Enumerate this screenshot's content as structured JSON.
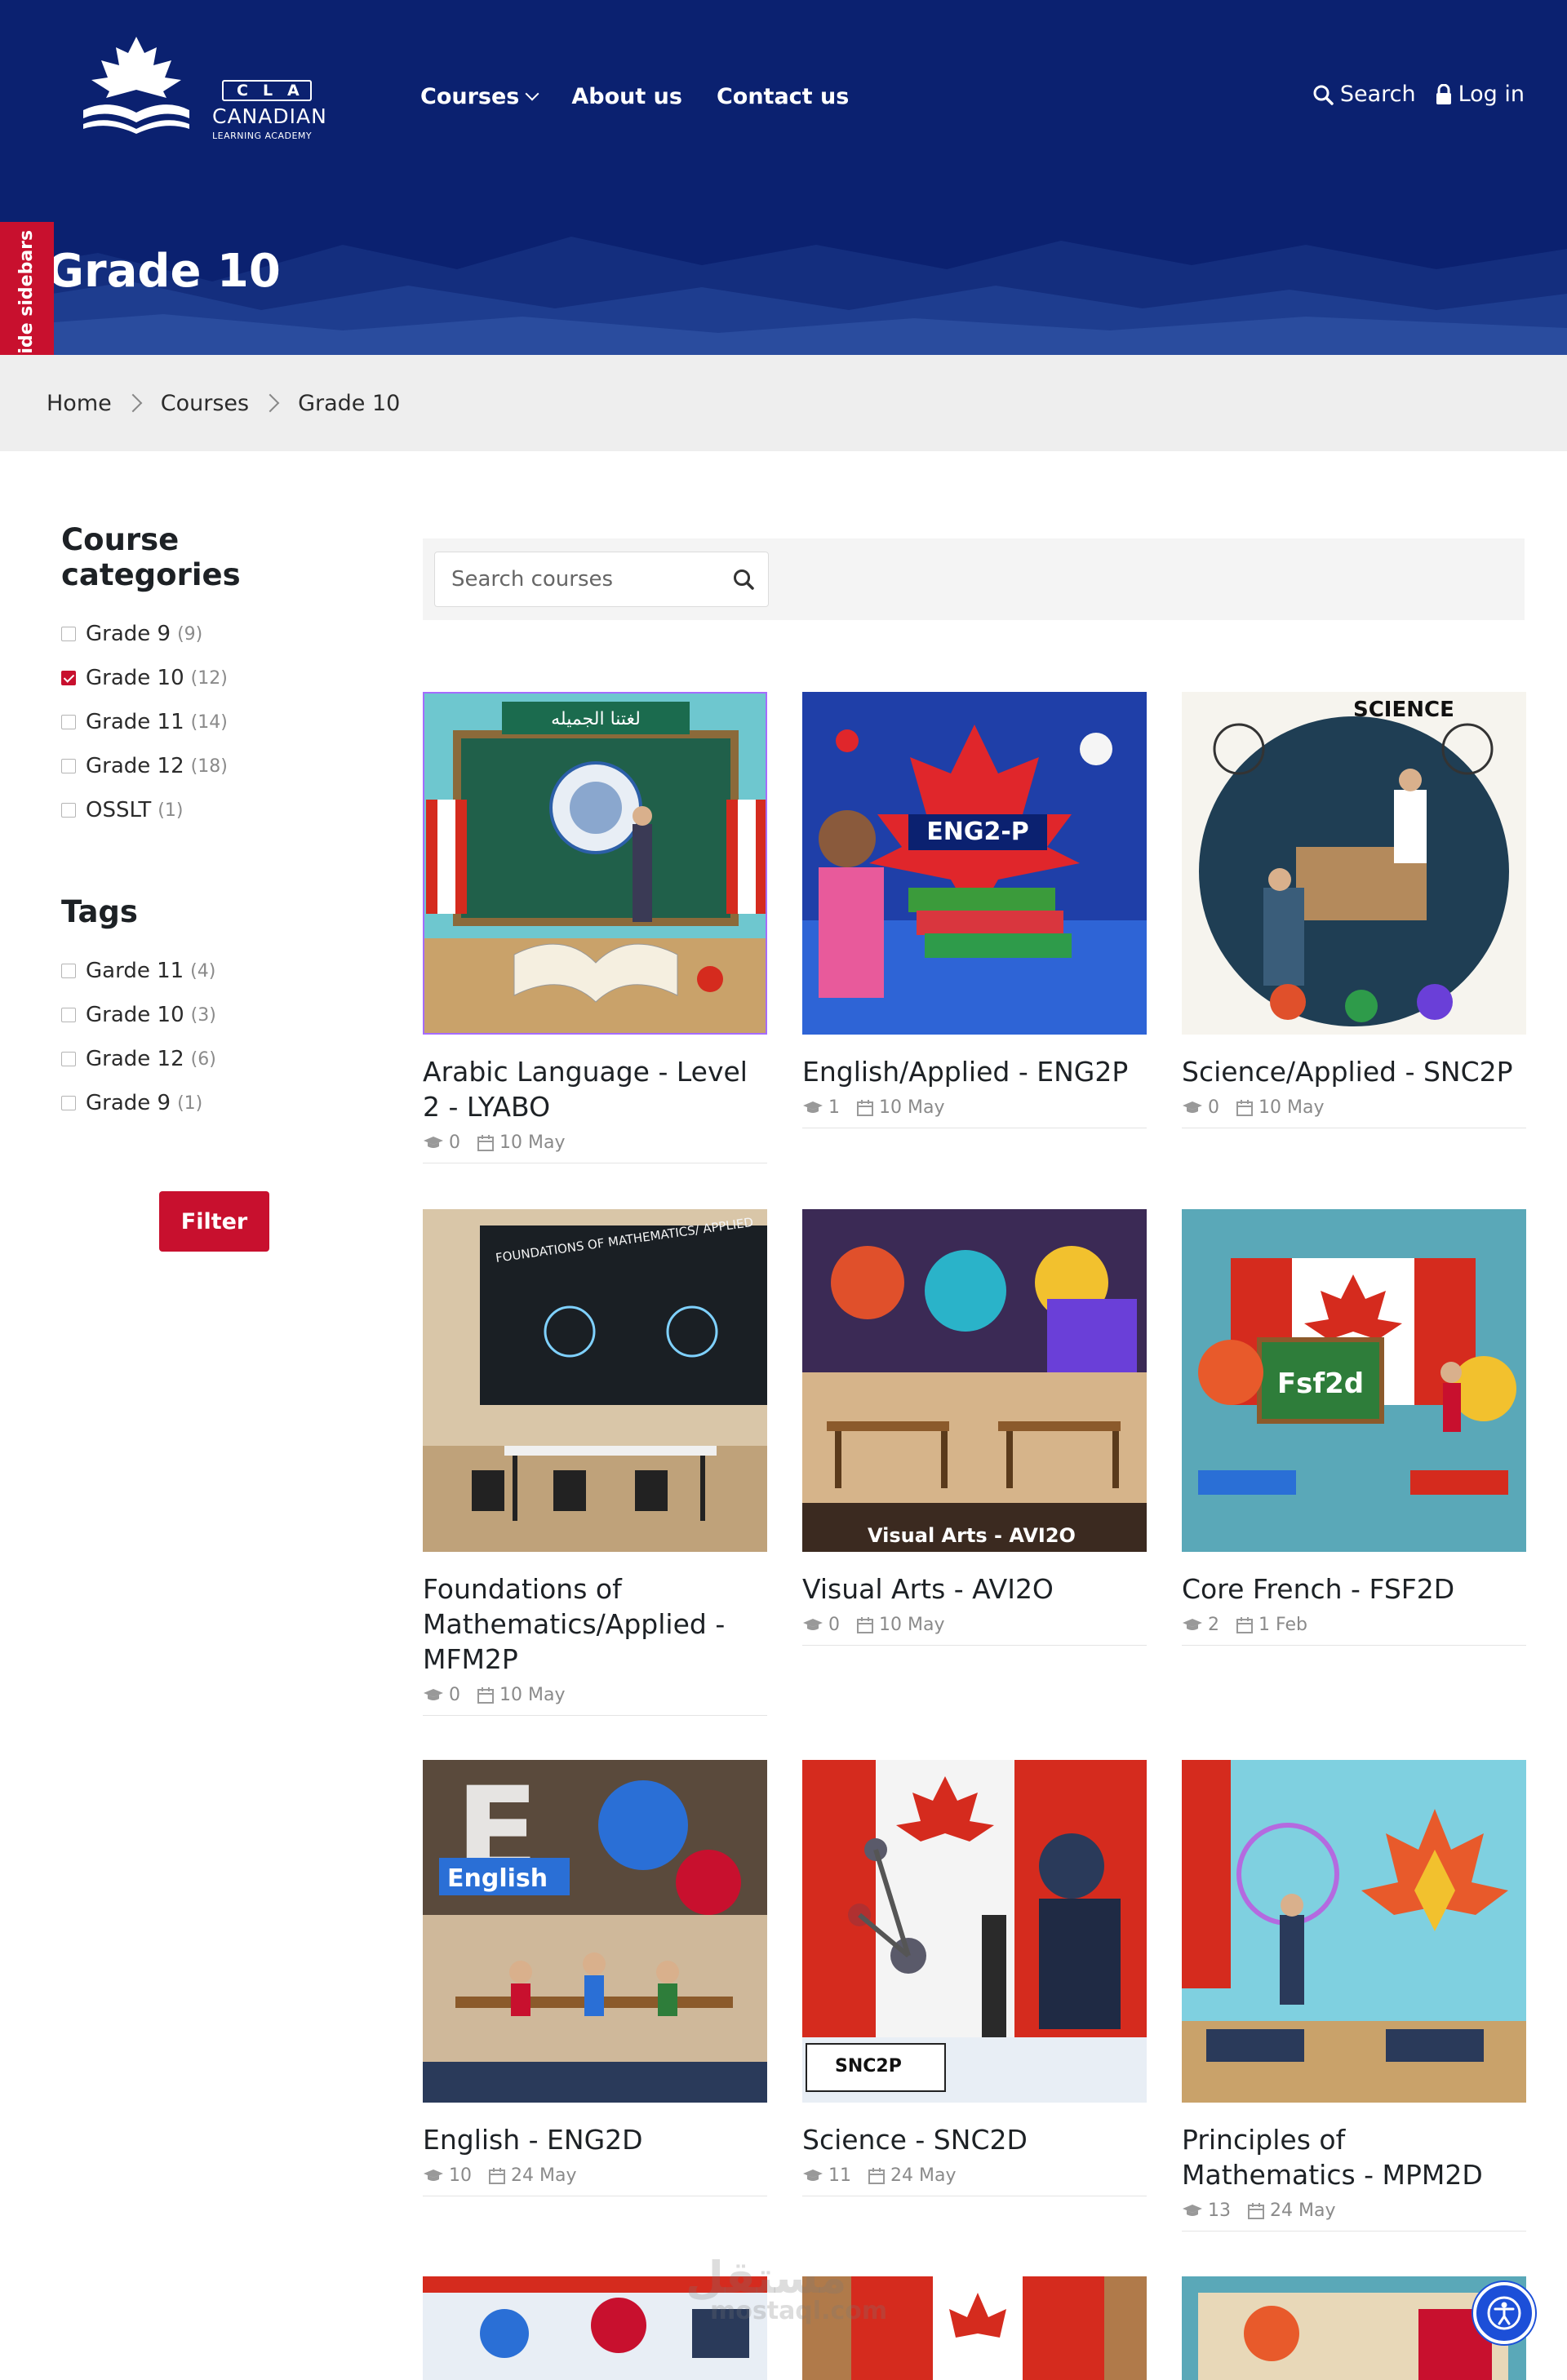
{
  "header": {
    "logo": {
      "badge": "CLA",
      "name": "CANADIAN",
      "sub": "LEARNING ACADEMY"
    },
    "nav": [
      {
        "label": "Courses",
        "icon": "chevron-down-icon"
      },
      {
        "label": "About us"
      },
      {
        "label": "Contact us"
      }
    ],
    "search_label": "Search",
    "login_label": "Log in",
    "page_title": "Grade 10",
    "colors": {
      "header_bg": "#0b2170",
      "accent": "#c8102e"
    }
  },
  "sidebar_toggle": {
    "label": "Hide sidebars",
    "icon": "bar-chart-icon"
  },
  "breadcrumb": [
    "Home",
    "Courses",
    "Grade 10"
  ],
  "filters": {
    "categories_heading": "Course categories",
    "categories": [
      {
        "label": "Grade 9",
        "count": "(9)",
        "checked": false
      },
      {
        "label": "Grade 10",
        "count": "(12)",
        "checked": true
      },
      {
        "label": "Grade 11",
        "count": "(14)",
        "checked": false
      },
      {
        "label": "Grade 12",
        "count": "(18)",
        "checked": false
      },
      {
        "label": "OSSLT",
        "count": "(1)",
        "checked": false
      }
    ],
    "tags_heading": "Tags",
    "tags": [
      {
        "label": "Garde 11",
        "count": "(4)",
        "checked": false
      },
      {
        "label": "Grade 10",
        "count": "(3)",
        "checked": false
      },
      {
        "label": "Grade 12",
        "count": "(6)",
        "checked": false
      },
      {
        "label": "Grade 9",
        "count": "(1)",
        "checked": false
      }
    ],
    "filter_button": "Filter"
  },
  "search": {
    "placeholder": "Search courses"
  },
  "courses": [
    {
      "title": "Arabic Language - Level 2 - LYABO",
      "students": "0",
      "date": "10 May",
      "thumb_text": "لغتنا الجميله"
    },
    {
      "title": "English/Applied - ENG2P",
      "students": "1",
      "date": "10 May",
      "thumb_text": "ENG2-P"
    },
    {
      "title": "Science/Applied - SNC2P",
      "students": "0",
      "date": "10 May",
      "thumb_text": "SCIENCE"
    },
    {
      "title": "Foundations of Mathematics/Applied - MFM2P",
      "students": "0",
      "date": "10 May",
      "thumb_text": "FOUNDATIONS OF MATHEMATICS/ APPLIED"
    },
    {
      "title": "Visual Arts - AVI2O",
      "students": "0",
      "date": "10 May",
      "thumb_text": "Visual Arts - AVI2O"
    },
    {
      "title": "Core French - FSF2D",
      "students": "2",
      "date": "1 Feb",
      "thumb_text": "Fsf2d"
    },
    {
      "title": "English - ENG2D",
      "students": "10",
      "date": "24 May",
      "thumb_text": "English"
    },
    {
      "title": "Science - SNC2D",
      "students": "11",
      "date": "24 May",
      "thumb_text": "SNC2P"
    },
    {
      "title": "Principles of Mathematics - MPM2D",
      "students": "13",
      "date": "24 May",
      "thumb_text": ""
    }
  ],
  "watermark": {
    "line1": "مستقل",
    "line2": "mostaql.com"
  }
}
